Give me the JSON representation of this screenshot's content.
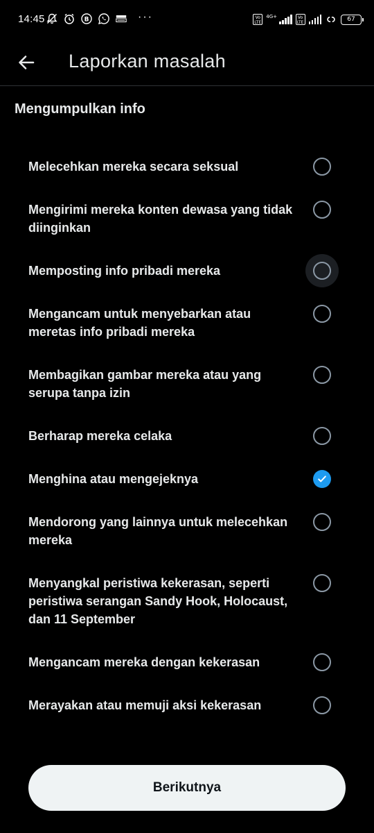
{
  "status_bar": {
    "time": "14:45",
    "net_type": "4G+",
    "lte_tag_1": "Vo LTE",
    "lte_tag_2": "Vo LTE",
    "battery": "67",
    "dots": "···"
  },
  "header": {
    "title": "Laporkan masalah"
  },
  "section": {
    "title": "Mengumpulkan info"
  },
  "options": [
    {
      "label": "Melecehkan mereka secara seksual",
      "checked": false
    },
    {
      "label": "Mengirimi mereka konten dewasa yang tidak diinginkan",
      "checked": false
    },
    {
      "label": "Memposting info pribadi mereka",
      "checked": false,
      "focused": true
    },
    {
      "label": "Mengancam untuk menyebarkan atau meretas info pribadi mereka",
      "checked": false
    },
    {
      "label": "Membagikan gambar mereka atau yang serupa tanpa izin",
      "checked": false
    },
    {
      "label": "Berharap mereka celaka",
      "checked": false
    },
    {
      "label": "Menghina atau mengejeknya",
      "checked": true
    },
    {
      "label": "Mendorong yang lainnya untuk melecehkan mereka",
      "checked": false
    },
    {
      "label": "Menyangkal peristiwa kekerasan, seperti peristiwa serangan Sandy Hook, Holocaust, dan 11 September",
      "checked": false
    },
    {
      "label": "Mengancam mereka dengan kekerasan",
      "checked": false
    },
    {
      "label": "Merayakan atau memuji aksi kekerasan",
      "checked": false
    }
  ],
  "footer": {
    "next_label": "Berikutnya"
  },
  "colors": {
    "background": "#000000",
    "text": "#e7e9ea",
    "accent": "#1d9bf0",
    "radio_border": "#8b98a5",
    "button_bg": "#eff3f4",
    "button_text": "#0f1419"
  }
}
